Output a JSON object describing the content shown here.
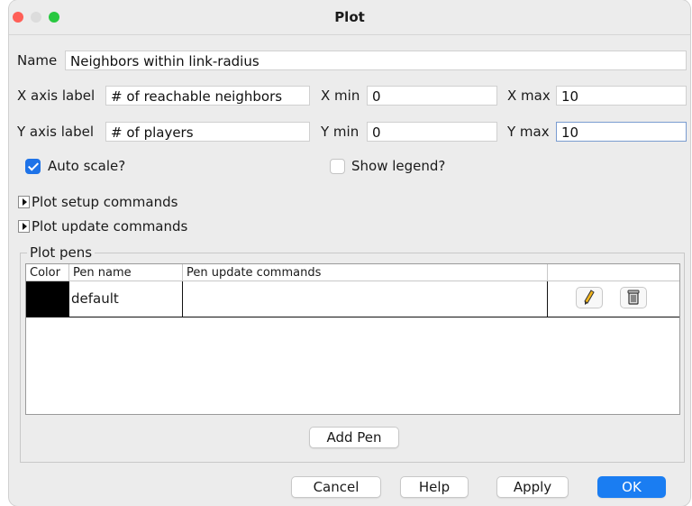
{
  "window": {
    "title": "Plot"
  },
  "form": {
    "name_label": "Name",
    "name_value": "Neighbors within link-radius",
    "x_axis_label": "X axis label",
    "x_axis_value": "# of reachable neighbors",
    "x_min_label": "X min",
    "x_min_value": "0",
    "x_max_label": "X max",
    "x_max_value": "10",
    "y_axis_label": "Y axis label",
    "y_axis_value": "# of players",
    "y_min_label": "Y min",
    "y_min_value": "0",
    "y_max_label": "Y max",
    "y_max_value": "10"
  },
  "options": {
    "auto_scale_label": "Auto scale?",
    "auto_scale_checked": true,
    "show_legend_label": "Show legend?",
    "show_legend_checked": false
  },
  "sections": {
    "setup_commands": "Plot setup commands",
    "update_commands": "Plot update commands"
  },
  "pens": {
    "group_title": "Plot pens",
    "columns": [
      "Color",
      "Pen name",
      "Pen update commands"
    ],
    "rows": [
      {
        "color": "#000000",
        "name": "default",
        "update": ""
      }
    ],
    "add_pen_label": "Add Pen",
    "edit_icon": "pencil-icon",
    "delete_icon": "trash-icon"
  },
  "buttons": {
    "cancel": "Cancel",
    "help": "Help",
    "apply": "Apply",
    "ok": "OK"
  },
  "colors": {
    "accent": "#1a7df2",
    "checkbox": "#1e73e8"
  }
}
